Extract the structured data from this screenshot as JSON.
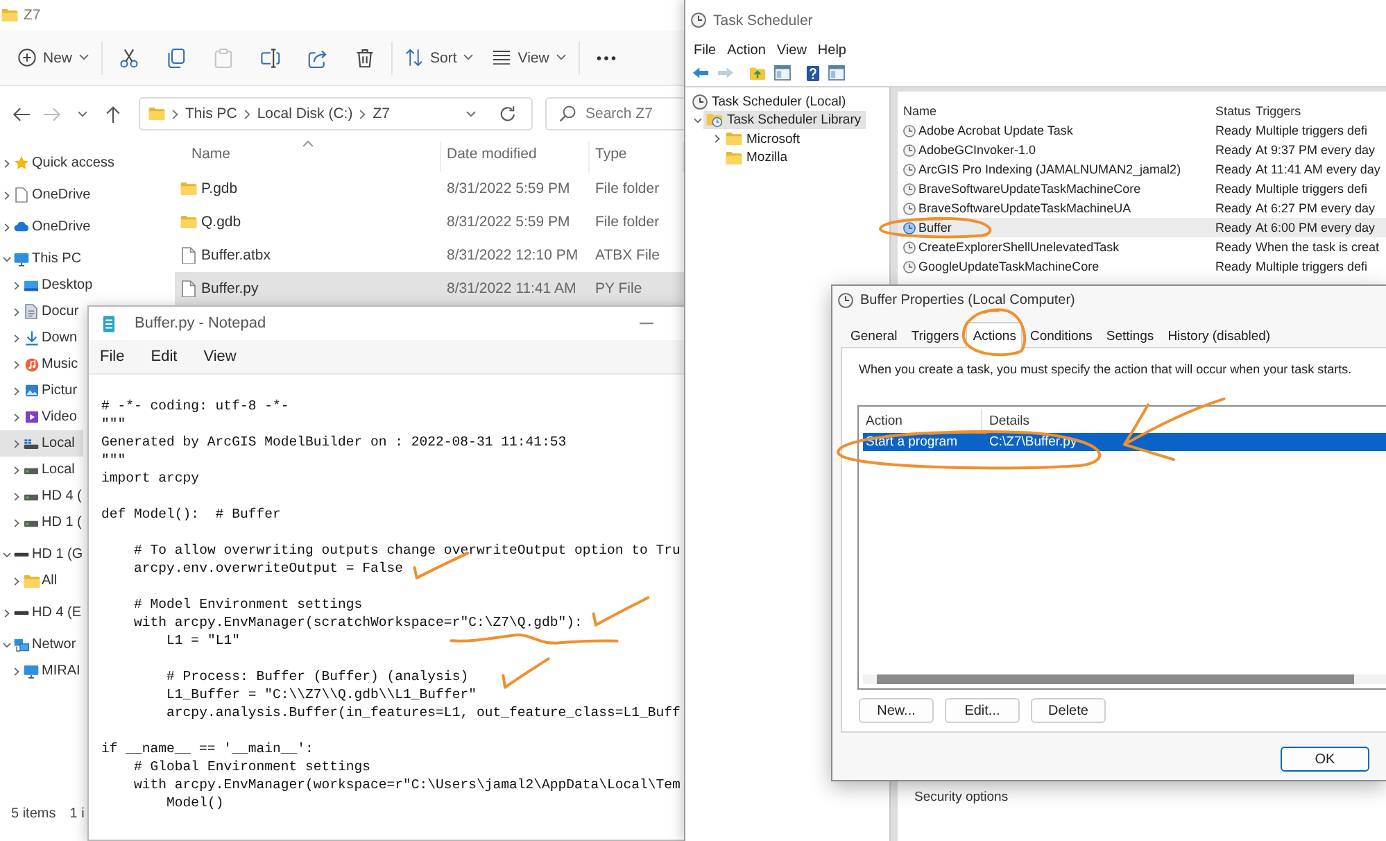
{
  "explorer": {
    "title": "Z7",
    "toolbar": [
      [
        {
          "kind": "new",
          "label": "New",
          "disabled": false
        }
      ],
      [
        {
          "kind": "cut",
          "disabled": false
        },
        {
          "kind": "copy",
          "disabled": false
        },
        {
          "kind": "paste",
          "disabled": true
        },
        {
          "kind": "rename",
          "disabled": false
        },
        {
          "kind": "share",
          "disabled": false
        },
        {
          "kind": "delete",
          "disabled": false
        }
      ],
      [
        {
          "kind": "sort",
          "label": "Sort",
          "disabled": false
        },
        {
          "kind": "view",
          "label": "View",
          "disabled": false
        }
      ],
      [
        {
          "kind": "more",
          "disabled": false
        }
      ]
    ],
    "nav": [
      {
        "kind": "back",
        "disabled": false
      },
      {
        "kind": "forward",
        "disabled": true
      },
      {
        "kind": "recent",
        "disabled": false
      },
      {
        "kind": "up",
        "disabled": false
      }
    ],
    "breadcrumb": [
      "This PC",
      "Local Disk (C:)",
      "Z7"
    ],
    "search": {
      "placeholder": "Search Z7"
    },
    "sidebar": [
      {
        "kind": "star",
        "label": "Quick access",
        "expanded": false,
        "selected": false
      },
      {
        "kind": "document",
        "label": "OneDrive",
        "expanded": false,
        "selected": false
      },
      {
        "kind": "cloud",
        "label": "OneDrive",
        "expanded": false,
        "selected": false
      },
      {
        "kind": "computer",
        "label": "This PC",
        "expanded": true,
        "selected": false,
        "children": [
          {
            "kind": "desktop",
            "label": "Desktop",
            "expanded": false,
            "selected": false
          },
          {
            "kind": "documents",
            "label": "Docur",
            "expanded": false,
            "selected": false
          },
          {
            "kind": "download",
            "label": "Down",
            "expanded": false,
            "selected": false
          },
          {
            "kind": "music",
            "label": "Music",
            "expanded": false,
            "selected": false
          },
          {
            "kind": "pictures",
            "label": "Pictur",
            "expanded": false,
            "selected": false
          },
          {
            "kind": "videos",
            "label": "Video",
            "expanded": false,
            "selected": false
          },
          {
            "kind": "system-drive",
            "label": "Local",
            "expanded": false,
            "selected": true
          },
          {
            "kind": "drive",
            "label": "Local",
            "expanded": false,
            "selected": false
          },
          {
            "kind": "drive",
            "label": "HD 4 (",
            "expanded": false,
            "selected": false
          },
          {
            "kind": "drive",
            "label": "HD 1 (",
            "expanded": false,
            "selected": false
          }
        ]
      },
      {
        "kind": "usb-drive",
        "label": "HD 1 (G",
        "expanded": true,
        "selected": false,
        "children": [
          {
            "kind": "folder",
            "label": "All",
            "expanded": false,
            "selected": false
          }
        ]
      },
      {
        "kind": "usb-drive",
        "label": "HD 4 (E",
        "expanded": false,
        "selected": false
      },
      {
        "kind": "network",
        "label": "Networ",
        "expanded": true,
        "selected": false,
        "children": [
          {
            "kind": "computer",
            "label": "MIRAI",
            "expanded": false,
            "selected": false
          }
        ]
      }
    ],
    "columns": [
      {
        "label": "Name",
        "sorted": true
      },
      {
        "label": "Date modified",
        "sorted": false
      },
      {
        "label": "Type",
        "sorted": false
      }
    ],
    "files": [
      {
        "kind": "folder",
        "name": "P.gdb",
        "modified": "8/31/2022 5:59 PM",
        "type": "File folder",
        "selected": false
      },
      {
        "kind": "folder",
        "name": "Q.gdb",
        "modified": "8/31/2022 5:59 PM",
        "type": "File folder",
        "selected": false
      },
      {
        "kind": "file",
        "name": "Buffer.atbx",
        "modified": "8/31/2022 12:10 PM",
        "type": "ATBX File",
        "selected": false
      },
      {
        "kind": "file",
        "name": "Buffer.py",
        "modified": "8/31/2022 11:41 AM",
        "type": "PY File",
        "selected": true
      }
    ],
    "status": [
      "5 items",
      "1 i"
    ]
  },
  "notepad": {
    "title": "Buffer.py - Notepad",
    "menu": [
      "File",
      "Edit",
      "View"
    ],
    "code": [
      [
        "# -*- coding: utf-8 -*-",
        "\"\"\"",
        "Generated by ArcGIS ModelBuilder on : 2022-08-31 11:41:53",
        "\"\"\"",
        "import arcpy"
      ],
      [
        "def Model():  # Buffer"
      ],
      [
        "    # To allow overwriting outputs change overwriteOutput option to Tru",
        "    arcpy.env.overwriteOutput = False"
      ],
      [
        "    # Model Environment settings",
        "    with arcpy.EnvManager(scratchWorkspace=r\"C:\\Z7\\Q.gdb\"):",
        "        L1 = \"L1\""
      ],
      [
        "        # Process: Buffer (Buffer) (analysis)",
        "        L1_Buffer = \"C:\\\\Z7\\\\Q.gdb\\\\L1_Buffer\"",
        "        arcpy.analysis.Buffer(in_features=L1, out_feature_class=L1_Buff"
      ],
      [
        "if __name__ == '__main__':",
        "    # Global Environment settings",
        "    with arcpy.EnvManager(workspace=r\"C:\\Users\\jamal2\\AppData\\Local\\Tem",
        "        Model()"
      ]
    ]
  },
  "task_scheduler": {
    "title": "Task Scheduler",
    "menu": [
      "File",
      "Action",
      "View",
      "Help"
    ],
    "toolbar": [
      [
        {
          "kind": "back",
          "disabled": false
        },
        {
          "kind": "forward",
          "disabled": true
        }
      ],
      [
        {
          "kind": "folder-up",
          "disabled": false
        },
        {
          "kind": "pane",
          "disabled": false
        }
      ],
      [
        {
          "kind": "help",
          "disabled": false
        },
        {
          "kind": "pane",
          "disabled": false
        }
      ]
    ],
    "tree": [
      {
        "kind": "clock",
        "label": "Task Scheduler (Local)",
        "selected": false,
        "children": [
          {
            "kind": "library",
            "label": "Task Scheduler Library",
            "expanded": true,
            "selected": true,
            "children": [
              {
                "kind": "folder",
                "label": "Microsoft",
                "expanded": false,
                "selected": false
              },
              {
                "kind": "folder",
                "label": "Mozilla",
                "selected": false
              }
            ]
          }
        ]
      }
    ],
    "columns": [
      "Name",
      "Status",
      "Triggers"
    ],
    "tasks": [
      {
        "name": "Adobe Acrobat Update Task",
        "status": "Ready",
        "triggers": "Multiple triggers defi",
        "selected": false
      },
      {
        "name": "AdobeGCInvoker-1.0",
        "status": "Ready",
        "triggers": "At 9:37 PM every day",
        "selected": false
      },
      {
        "name": "ArcGIS Pro Indexing (JAMALNUMAN2_jamal2)",
        "status": "Ready",
        "triggers": "At 11:41 AM every day",
        "selected": false
      },
      {
        "name": "BraveSoftwareUpdateTaskMachineCore",
        "status": "Ready",
        "triggers": "Multiple triggers defi",
        "selected": false
      },
      {
        "name": "BraveSoftwareUpdateTaskMachineUA",
        "status": "Ready",
        "triggers": "At 6:27 PM every day",
        "selected": false
      },
      {
        "name": "Buffer",
        "status": "Ready",
        "triggers": "At 6:00 PM every day",
        "selected": true
      },
      {
        "name": "CreateExplorerShellUnelevatedTask",
        "status": "Ready",
        "triggers": "When the task is creat",
        "selected": false
      },
      {
        "name": "GoogleUpdateTaskMachineCore",
        "status": "Ready",
        "triggers": "Multiple triggers defi",
        "selected": false
      }
    ],
    "detail_section": "Security options"
  },
  "properties_dialog": {
    "title": "Buffer Properties (Local Computer)",
    "tabs": [
      {
        "label": "General",
        "selected": false
      },
      {
        "label": "Triggers",
        "selected": false
      },
      {
        "label": "Actions",
        "selected": true
      },
      {
        "label": "Conditions",
        "selected": false
      },
      {
        "label": "Settings",
        "selected": false
      },
      {
        "label": "History (disabled)",
        "selected": false
      }
    ],
    "description": "When you create a task, you must specify the action that will occur when your task starts.",
    "columns": [
      "Action",
      "Details"
    ],
    "actions": [
      {
        "action": "Start a program",
        "details": "C:\\Z7\\Buffer.py",
        "selected": true
      }
    ],
    "list_buttons": [
      "New...",
      "Edit...",
      "Delete"
    ],
    "footer_buttons": [
      {
        "label": "OK",
        "default": true
      }
    ]
  },
  "annotations": [
    {
      "kind": "checkmark"
    },
    {
      "kind": "checkmark"
    },
    {
      "kind": "underline"
    },
    {
      "kind": "checkmark"
    },
    {
      "kind": "circle"
    },
    {
      "kind": "circle"
    },
    {
      "kind": "circle"
    },
    {
      "kind": "arrow"
    }
  ]
}
